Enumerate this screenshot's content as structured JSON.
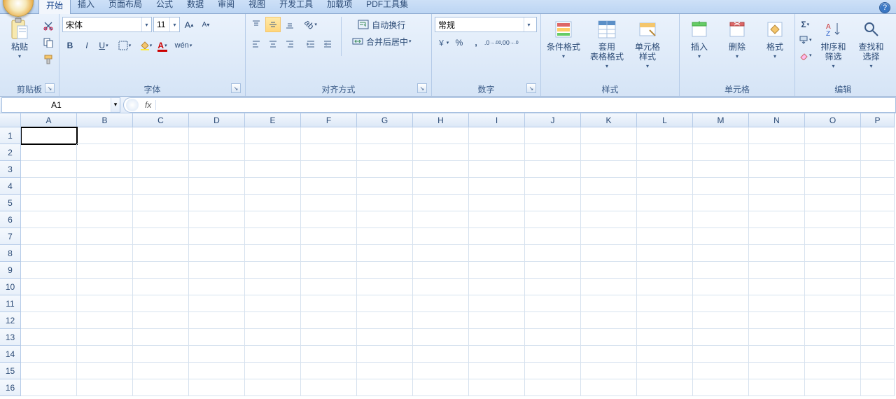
{
  "tabs": {
    "items": [
      "开始",
      "插入",
      "页面布局",
      "公式",
      "数据",
      "审阅",
      "视图",
      "开发工具",
      "加载项",
      "PDF工具集"
    ],
    "active_index": 0
  },
  "clipboard": {
    "paste": "粘贴",
    "group": "剪贴板"
  },
  "font": {
    "name": "宋体",
    "size": "11",
    "group": "字体"
  },
  "alignment": {
    "wrap": "自动换行",
    "merge": "合并后居中",
    "group": "对齐方式"
  },
  "number": {
    "format": "常规",
    "group": "数字"
  },
  "styles": {
    "cond": "条件格式",
    "table": "套用\n表格格式",
    "cell": "单元格\n样式",
    "group": "样式"
  },
  "cells": {
    "insert": "插入",
    "delete": "删除",
    "format": "格式",
    "group": "单元格"
  },
  "editing": {
    "sort": "排序和\n筛选",
    "find": "查找和\n选择",
    "group": "编辑"
  },
  "namebox": {
    "value": "A1",
    "fx": "fx"
  },
  "columns": [
    "A",
    "B",
    "C",
    "D",
    "E",
    "F",
    "G",
    "H",
    "I",
    "J",
    "K",
    "L",
    "M",
    "N",
    "O",
    "P"
  ],
  "rows": [
    "1",
    "2",
    "3",
    "4",
    "5",
    "6",
    "7",
    "8",
    "9",
    "10",
    "11",
    "12",
    "13",
    "14",
    "15",
    "16"
  ]
}
